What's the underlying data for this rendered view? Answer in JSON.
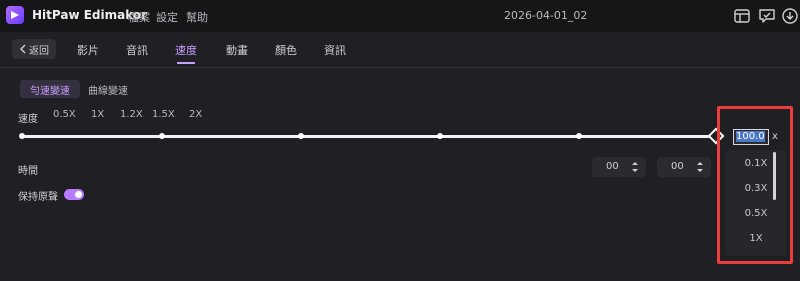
{
  "app": {
    "name": "HitPaw Edimakor",
    "project_title": "2026-04-01_02",
    "menu": [
      "檔案",
      "設定",
      "幫助"
    ],
    "icons": [
      "layout-icon",
      "feedback-icon",
      "download-icon"
    ]
  },
  "tabbar": {
    "back_label": "返回",
    "tabs": [
      "影片",
      "音訊",
      "速度",
      "動畫",
      "顏色",
      "資訊"
    ],
    "active_tab": "速度"
  },
  "speed_panel": {
    "subtabs": [
      "勻速變速",
      "曲線變速"
    ],
    "active_subtab": "勻速變速",
    "speed_label": "速度",
    "presets": [
      "0.5X",
      "1X",
      "1.2X",
      "1.5X",
      "2X"
    ],
    "speed_value": "100.0",
    "speed_unit": "x",
    "time_label": "時間",
    "time_fields": [
      "00",
      "00"
    ],
    "keep_pitch_label": "保持原聲",
    "keep_pitch_on": true
  },
  "dropdown": {
    "options": [
      "0.1X",
      "0.3X",
      "0.5X",
      "1X"
    ]
  },
  "colors": {
    "accent": "#c89dff",
    "highlight_border": "#ec3c3c"
  }
}
